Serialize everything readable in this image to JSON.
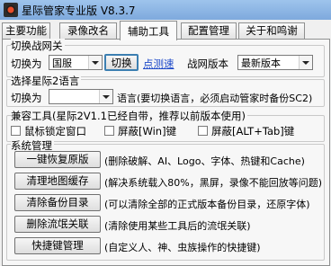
{
  "window": {
    "title": "星际管家专业版 V8.3.7"
  },
  "tabs": [
    {
      "label": "主要功能"
    },
    {
      "label": "录像改名"
    },
    {
      "label": "辅助工具"
    },
    {
      "label": "配置管理"
    },
    {
      "label": "关于和鸣谢"
    }
  ],
  "switch_net": {
    "title": "切换战网关",
    "switch_to_label": "切换为",
    "region_value": "国服",
    "switch_button": "切换",
    "speedtest_link": "点测速",
    "version_label": "战网版本",
    "version_value": "最新版本"
  },
  "language": {
    "title": "选择星际2语言",
    "switch_to_label": "切换为",
    "language_value": "",
    "note": "语言(要切换语言，必须启动管家时备份SC2)"
  },
  "compat": {
    "title": "兼容工具(星际2V1.1已经自带，推荐以前版本使用)",
    "options": [
      {
        "label": "鼠标锁定窗口",
        "checked": false
      },
      {
        "label": "屏蔽[Win]键",
        "checked": false
      },
      {
        "label": "屏蔽[ALT+Tab]键",
        "checked": false
      }
    ]
  },
  "system": {
    "title": "系统管理",
    "actions": [
      {
        "button": "一键恢复原版",
        "desc": "(删除破解、AI、Logo、字体、热键和Cache)"
      },
      {
        "button": "清理地图缓存",
        "desc": "(解决系统载入80%，黑屏，录像不能回放等问题)"
      },
      {
        "button": "清除备份目录",
        "desc": "(可以清除全部的正式版本备份目录，还原字体)"
      },
      {
        "button": "删除流氓关联",
        "desc": "(清除使用某些工具后的流氓关联)"
      },
      {
        "button": "快捷键管理",
        "desc": "(自定义人、神、虫族操作的快捷键)"
      }
    ]
  }
}
